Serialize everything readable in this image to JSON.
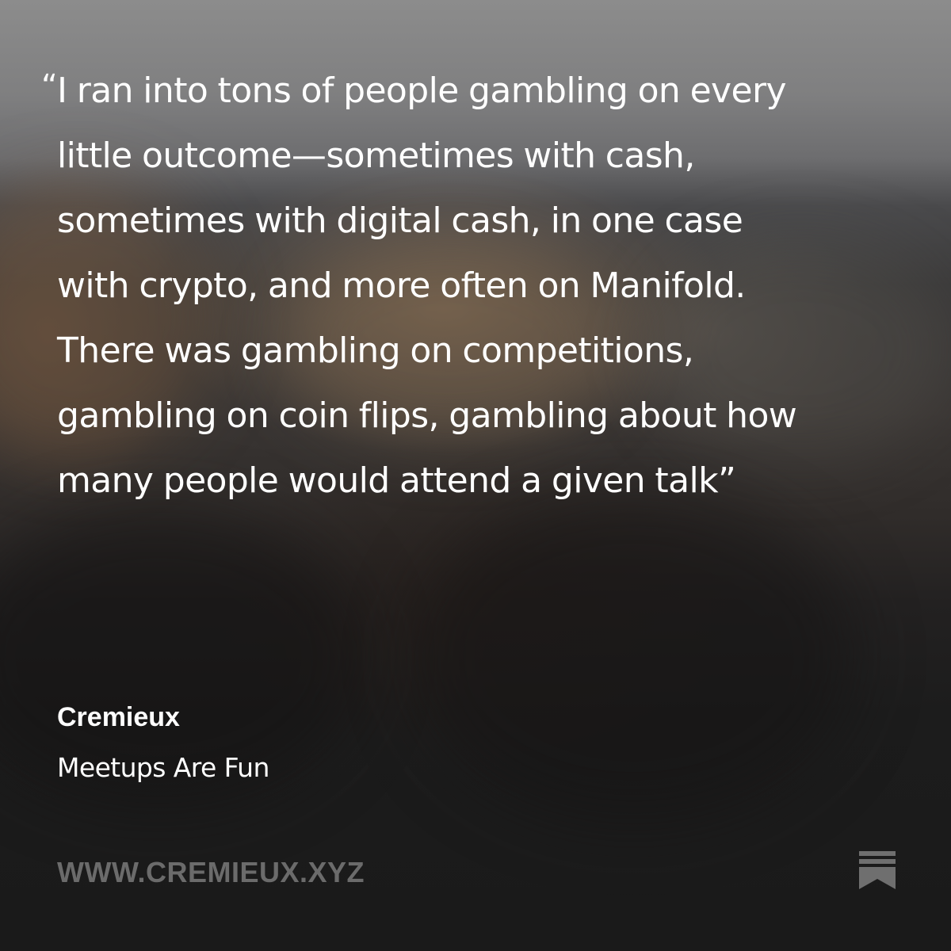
{
  "quote": {
    "open_mark": "“",
    "lines": [
      "I ran into tons of people gambling on every",
      "little outcome—sometimes with cash,",
      "sometimes with digital cash, in one case",
      "with crypto, and more often on Manifold.",
      "There was gambling on competitions,",
      "gambling on coin flips, gambling about how",
      "many people would attend a given talk”"
    ]
  },
  "author": "Cremieux",
  "post_title": "Meetups Are Fun",
  "site_url": "WWW.CREMIEUX.XYZ",
  "brand_icon": "substack-logo-icon",
  "colors": {
    "text": "#ffffff",
    "url_text": "#6b6b6b",
    "icon": "#6f6f6f"
  }
}
